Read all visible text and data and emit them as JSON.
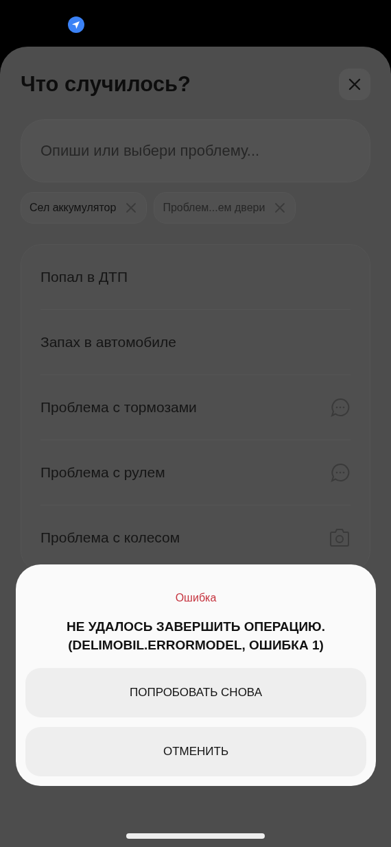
{
  "sheet": {
    "title": "Что случилось?",
    "search": {
      "placeholder": "Опиши или выбери проблему..."
    },
    "chips": [
      {
        "label": "Сел аккумулятор"
      },
      {
        "label": "Проблем...ем двери"
      }
    ],
    "items": [
      {
        "label": "Попал в ДТП",
        "kind": "plain"
      },
      {
        "label": "Запах в автомобиле",
        "kind": "plain"
      },
      {
        "label": "Проблема с тормозами",
        "kind": "chat"
      },
      {
        "label": "Проблема с рулем",
        "kind": "chat"
      },
      {
        "label": "Проблема с колесом",
        "kind": "camera"
      }
    ]
  },
  "dialog": {
    "title": "Ошибка",
    "message": "НЕ УДАЛОСЬ ЗАВЕРШИТЬ ОПЕРАЦИЮ. (DELIMOBIL.ERRORMODEL, ОШИБКА 1)",
    "buttons": [
      "ПОПРОБОВАТЬ СНОВА",
      "ОТМЕНИТЬ"
    ]
  }
}
